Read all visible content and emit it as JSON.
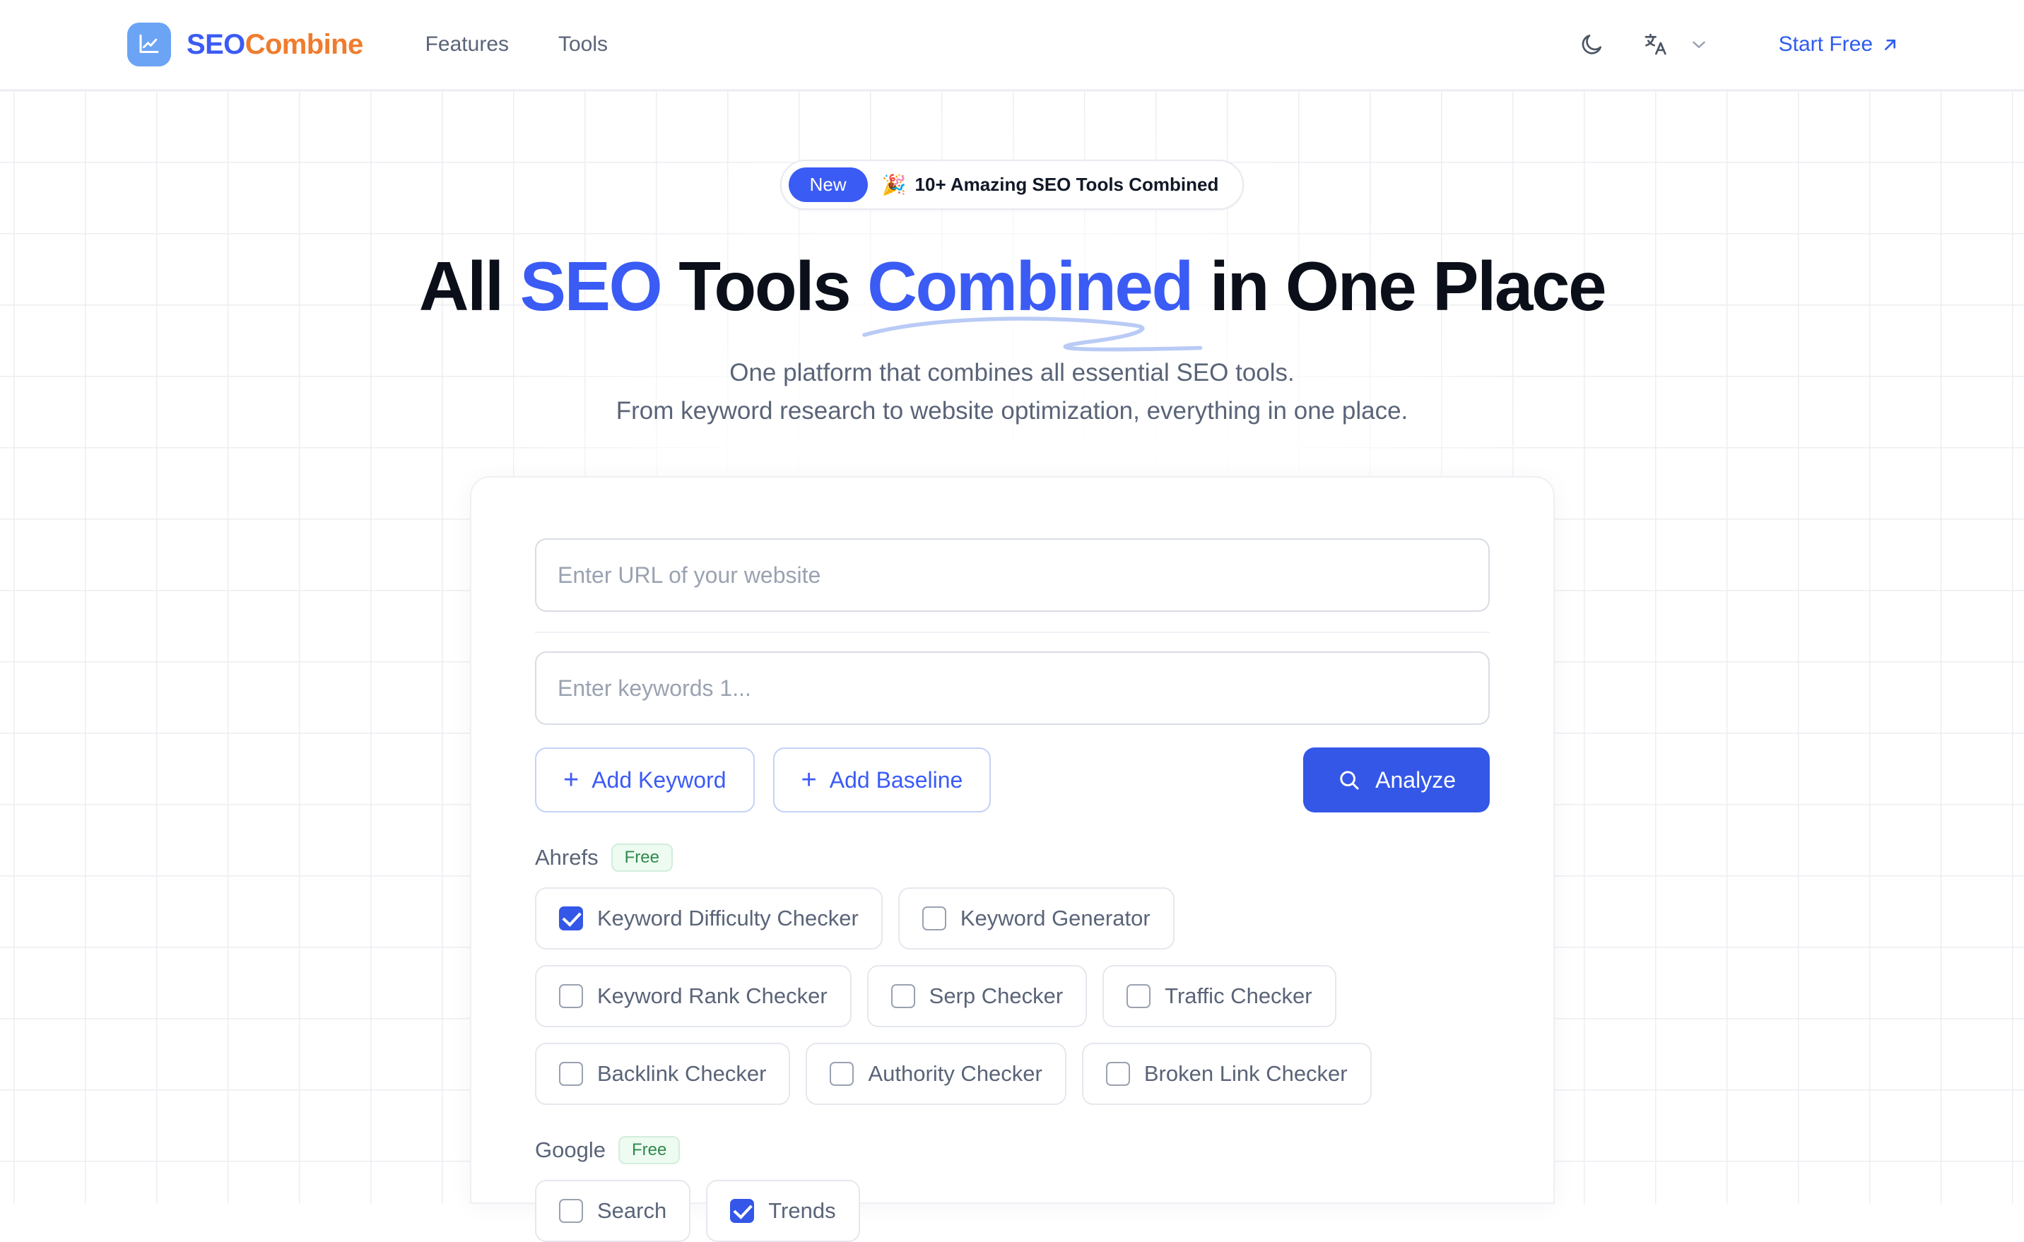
{
  "header": {
    "brand": {
      "part1": "SEO",
      "part2": "Combine",
      "logo_icon": "line-chart-icon"
    },
    "nav": [
      {
        "label": "Features"
      },
      {
        "label": "Tools"
      }
    ],
    "dark_mode_icon": "moon-icon",
    "language_icon": "translate-icon",
    "language_chevron_icon": "chevron-down-icon",
    "cta": {
      "label": "Start Free",
      "icon": "arrow-up-right-icon",
      "color": "#2f5cf0"
    }
  },
  "hero": {
    "badge": {
      "pill": "New",
      "emoji": "🎉",
      "text": "10+ Amazing SEO Tools Combined"
    },
    "headline": {
      "p1": "All ",
      "p2_blue": "SEO",
      "p3": " Tools ",
      "p4_blue_underlined": "Combined",
      "p5": " in One Place"
    },
    "subtitle_line1": "One platform that combines all essential SEO tools.",
    "subtitle_line2": "From keyword research to website optimization, everything in one place."
  },
  "form": {
    "url_placeholder": "Enter URL of your website",
    "keyword_placeholder": "Enter keywords 1...",
    "url_value": "",
    "keyword_value": "",
    "add_keyword_label": "Add Keyword",
    "add_baseline_label": "Add Baseline",
    "plus_icon": "plus-icon",
    "analyze_label": "Analyze",
    "analyze_icon": "search-icon",
    "accent_color": "#3457e8"
  },
  "tool_groups": [
    {
      "name": "Ahrefs",
      "badge": "Free",
      "tools": [
        {
          "label": "Keyword Difficulty Checker",
          "checked": true
        },
        {
          "label": "Keyword Generator",
          "checked": false
        },
        {
          "label": "Keyword Rank Checker",
          "checked": false
        },
        {
          "label": "Serp Checker",
          "checked": false
        },
        {
          "label": "Traffic Checker",
          "checked": false
        },
        {
          "label": "Backlink Checker",
          "checked": false
        },
        {
          "label": "Authority Checker",
          "checked": false
        },
        {
          "label": "Broken Link Checker",
          "checked": false
        }
      ]
    },
    {
      "name": "Google",
      "badge": "Free",
      "tools": [
        {
          "label": "Search",
          "checked": false
        },
        {
          "label": "Trends",
          "checked": true
        }
      ]
    }
  ]
}
